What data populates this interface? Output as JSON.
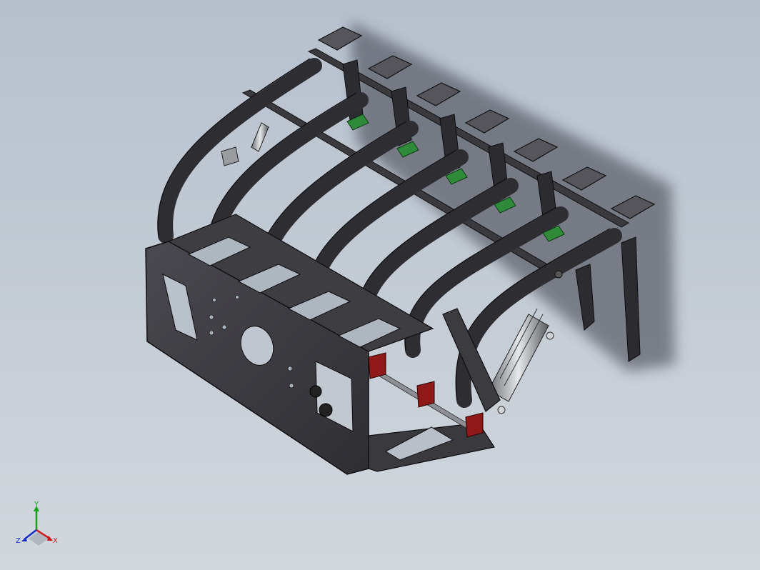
{
  "view": {
    "background_top": "#b6c0cd",
    "background_bottom": "#d2d7dd",
    "model_color": "#3b3a3f",
    "model_edge_color": "#111114",
    "accent_green": "#2e8b3a",
    "accent_red": "#9c1c1c"
  },
  "triad": {
    "x_label": "X",
    "y_label": "Y",
    "z_label": "Z",
    "x_color": "#d01818",
    "y_color": "#18a018",
    "z_color": "#1830c8"
  }
}
